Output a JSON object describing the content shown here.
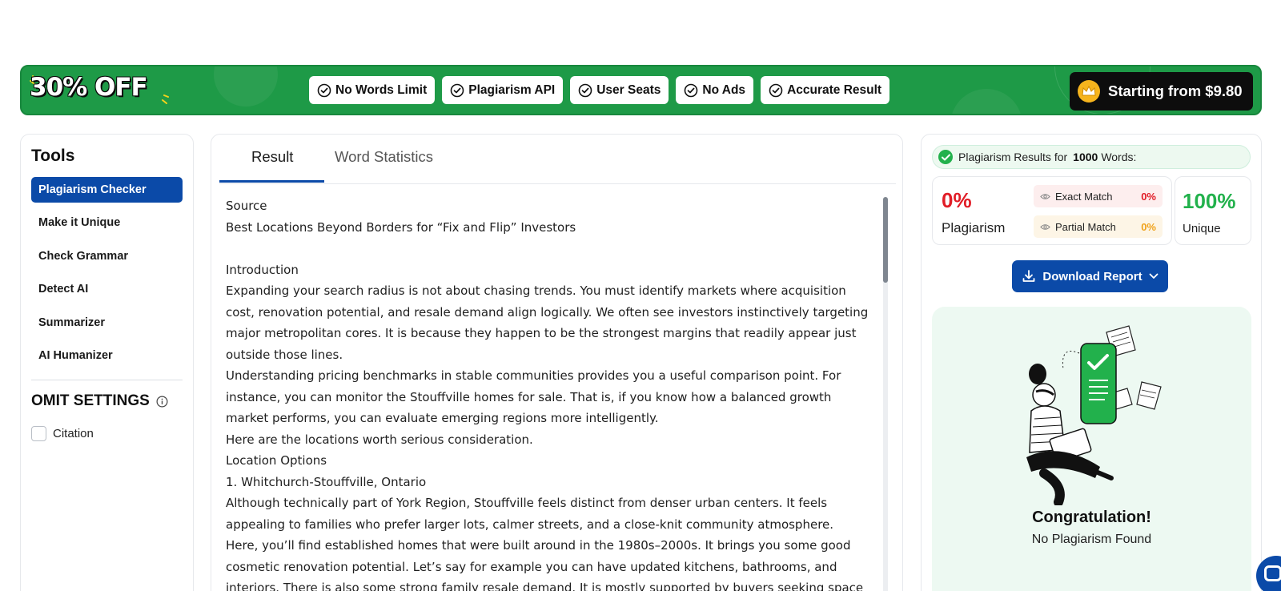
{
  "banner": {
    "offer": "30% OFF",
    "features": [
      "No Words Limit",
      "Plagiarism API",
      "User Seats",
      "No Ads",
      "Accurate Result"
    ],
    "price_label": "Starting from $9.80",
    "colors": {
      "background": "#1e9a47",
      "price_bg": "#0d0d0d"
    }
  },
  "tools": {
    "title": "Tools",
    "items": [
      "Plagiarism Checker",
      "Make it Unique",
      "Check Grammar",
      "Detect AI",
      "Summarizer",
      "AI Humanizer"
    ],
    "active_item": "Plagiarism Checker",
    "omit_title": "OMIT SETTINGS",
    "citation_label": "Citation",
    "citation_checked": false
  },
  "result": {
    "tabs": [
      "Result",
      "Word Statistics"
    ],
    "active_tab": "Result",
    "lines": [
      "Source",
      "Best Locations Beyond Borders for “Fix and Flip” Investors",
      "",
      "Introduction",
      "Expanding your search radius is not about chasing trends. You must identify markets where acquisition",
      "cost, renovation potential, and resale demand align logically. We often see investors instinctively targeting",
      "major metropolitan cores. It is because they happen to be the strongest margins that readily appear just",
      "outside those lines.",
      "Understanding pricing benchmarks in stable communities provides you a useful comparison point. For",
      "instance, you can monitor the Stouffville homes for sale. That is, if you know how a balanced growth",
      "market performs, you can evaluate emerging regions more intelligently.",
      "Here are the locations worth serious consideration.",
      "Location Options",
      "1. Whitchurch-Stouffville, Ontario",
      "Although technically part of York Region, Stouffville feels distinct from denser urban centers. It feels",
      "appealing to families who prefer larger lots, calmer streets, and a close-knit community atmosphere.",
      "Here, you’ll find established homes that were built around in the 1980s–2000s. It brings you some good",
      "cosmetic renovation potential. Let’s say for example you can have updated kitchens, bathrooms, and",
      "interiors. There is also some strong family resale demand. It is mostly supported by buyers seeking space"
    ]
  },
  "stats": {
    "header_prefix": "Plagiarism Results for",
    "word_count": "1000",
    "header_suffix": "Words:",
    "plagiarism_pct": "0%",
    "plagiarism_label": "Plagiarism",
    "exact_label": "Exact Match",
    "exact_pct": "0%",
    "partial_label": "Partial Match",
    "partial_pct": "0%",
    "unique_pct": "100%",
    "unique_label": "Unique",
    "download_label": "Download Report",
    "congrats_title": "Congratulation!",
    "congrats_sub": "No Plagiarism Found",
    "colors": {
      "plagiarism": "#e11d27",
      "unique": "#22b14c",
      "partial": "#f0a21b",
      "primary": "#0b4aa8"
    }
  },
  "icons": {
    "feature": "check-circle-icon",
    "price": "crown-icon",
    "info": "info-icon",
    "header": "check-circle-icon",
    "eye": "eye-icon",
    "download": "download-icon",
    "chevron": "chevron-down-icon",
    "chat": "chat-icon"
  }
}
